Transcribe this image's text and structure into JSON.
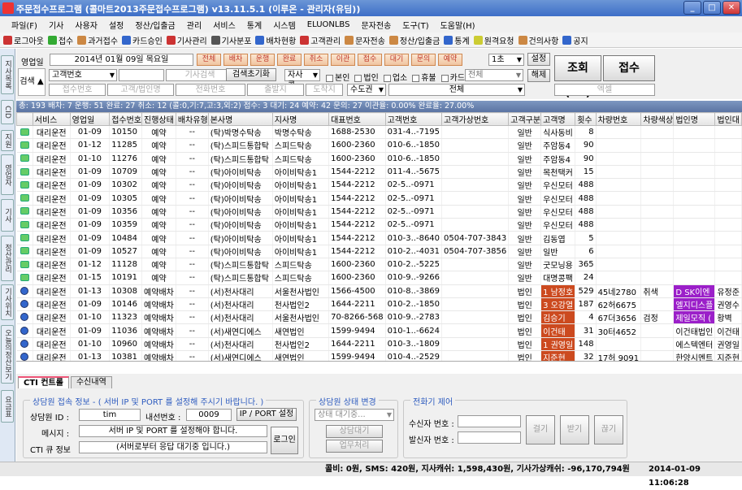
{
  "window": {
    "title": "주문접수프로그램 (콜마트2013주문접수프로그램) v13.11.5.1 (이루온 - 관리자(유딤))"
  },
  "menu": [
    "파일(F)",
    "기사",
    "사용자",
    "설정",
    "정산/입출금",
    "관리",
    "서비스",
    "통계",
    "시스템",
    "ELUONLBS",
    "문자전송",
    "도구(T)",
    "도움말(H)"
  ],
  "toolbar": [
    {
      "label": "로그아웃",
      "color": "#c33"
    },
    {
      "label": "접수",
      "color": "#3a3"
    },
    {
      "label": "과거접수",
      "color": "#c84"
    },
    {
      "label": "카드승인",
      "color": "#36c"
    },
    {
      "label": "기사관리",
      "color": "#c33"
    },
    {
      "label": "기사분포",
      "color": "#555"
    },
    {
      "label": "배차현황",
      "color": "#36c"
    },
    {
      "label": "고객관리",
      "color": "#c33"
    },
    {
      "label": "문자전송",
      "color": "#c84"
    },
    {
      "label": "정산/입출금",
      "color": "#c84"
    },
    {
      "label": "통계",
      "color": "#36c"
    },
    {
      "label": "원격요청",
      "color": "#cc3"
    },
    {
      "label": "건의사항",
      "color": "#c84"
    },
    {
      "label": "공지",
      "color": "#36c"
    }
  ],
  "sidebar_tabs": [
    "지사목록",
    "CID",
    "지원",
    "영업자",
    "기사",
    "정산관리",
    "기사위치",
    "오늘의정산보기",
    "요금표"
  ],
  "search": {
    "sales_day_label": "영업일",
    "date": "2014년 01월 09일 목요일",
    "filters": [
      "전체",
      "배차",
      "운행",
      "완료",
      "취소",
      "이관",
      "접수",
      "대기",
      "문의",
      "예약"
    ],
    "interval": "1초",
    "settings": "설정",
    "search_label": "검색",
    "customer_no": "고객번호",
    "driver_search_ph": "기사검색",
    "reset": "검색초기화",
    "hq_user": "자사콜",
    "chk_self": "본인",
    "chk_corp": "법인",
    "chk_biz": "업소",
    "chk_off": "휴불",
    "chk_card": "카드",
    "all_select": "전체",
    "release": "해제",
    "query_btn": "조회(F5)",
    "accept_btn": "접수",
    "ph_accept_no": "접수번호",
    "ph_customer": "고객/법인명",
    "ph_phone": "전화번호",
    "ph_depart": "출발지",
    "ph_arrive": "도착지",
    "region": "수도권",
    "all_combo": "전체",
    "excel": "엑셀"
  },
  "status_line": "총: 193  배차: 7  운행: 51  완료: 27  취소: 12 (콜:0,기:7,고:3,외:2)  접수: 3  대기: 24  예약: 42  문의: 27  이관율: 0.00%  완료율: 27.00%",
  "grid": {
    "columns": [
      "",
      "서비스",
      "영업일",
      "접수번호",
      "진행상태",
      "배차유형",
      "본사명",
      "지사명",
      "대표번호",
      "고객번호",
      "고객가상번호",
      "고객구분",
      "고객명",
      "횟수",
      "차량번호",
      "차량색상",
      "법인명",
      "법인대"
    ],
    "rows": [
      [
        "g",
        "대리운전",
        "01-09",
        "10150",
        "예약",
        "--",
        "(탁)박명수탁송",
        "박명수탁송",
        "1688-2530",
        "031-4..-7195",
        "",
        "일반",
        "식사동비",
        "8",
        "",
        "",
        "",
        ""
      ],
      [
        "g",
        "대리운전",
        "01-12",
        "11285",
        "예약",
        "--",
        "(탁)스피드통합탁",
        "스피드탁송",
        "1600-2360",
        "010-6..-1850",
        "",
        "일반",
        "주암동4",
        "90",
        "",
        "",
        "",
        ""
      ],
      [
        "g",
        "대리운전",
        "01-10",
        "11276",
        "예약",
        "--",
        "(탁)스피드통합탁",
        "스피드탁송",
        "1600-2360",
        "010-6..-1850",
        "",
        "일반",
        "주암동4",
        "90",
        "",
        "",
        "",
        ""
      ],
      [
        "g",
        "대리운전",
        "01-09",
        "10709",
        "예약",
        "--",
        "(탁)아이비탁송",
        "아이비탁송1",
        "1544-2212",
        "011-4..-5675",
        "",
        "일반",
        "목천택커",
        "15",
        "",
        "",
        "",
        ""
      ],
      [
        "g",
        "대리운전",
        "01-09",
        "10302",
        "예약",
        "--",
        "(탁)아이비탁송",
        "아이비탁송1",
        "1544-2212",
        "02-5..-0971",
        "",
        "일반",
        "우신모터",
        "488",
        "",
        "",
        "",
        ""
      ],
      [
        "g",
        "대리운전",
        "01-09",
        "10305",
        "예약",
        "--",
        "(탁)아이비탁송",
        "아이비탁송1",
        "1544-2212",
        "02-5..-0971",
        "",
        "일반",
        "우신모터",
        "488",
        "",
        "",
        "",
        ""
      ],
      [
        "g",
        "대리운전",
        "01-09",
        "10356",
        "예약",
        "--",
        "(탁)아이비탁송",
        "아이비탁송1",
        "1544-2212",
        "02-5..-0971",
        "",
        "일반",
        "우신모터",
        "488",
        "",
        "",
        "",
        ""
      ],
      [
        "g",
        "대리운전",
        "01-09",
        "10359",
        "예약",
        "--",
        "(탁)아이비탁송",
        "아이비탁송1",
        "1544-2212",
        "02-5..-0971",
        "",
        "일반",
        "우신모터",
        "488",
        "",
        "",
        "",
        ""
      ],
      [
        "g",
        "대리운전",
        "01-09",
        "10484",
        "예약",
        "--",
        "(탁)아이비탁송",
        "아이비탁송1",
        "1544-2212",
        "010-3..-8640",
        "0504-707-3843",
        "일반",
        "김동엽",
        "5",
        "",
        "",
        "",
        ""
      ],
      [
        "g",
        "대리운전",
        "01-09",
        "10527",
        "예약",
        "--",
        "(탁)아이비탁송",
        "아이비탁송1",
        "1544-2212",
        "010-2..-4031",
        "0504-707-3856",
        "일반",
        "일반",
        "6",
        "",
        "",
        "",
        ""
      ],
      [
        "g",
        "대리운전",
        "01-12",
        "11128",
        "예약",
        "--",
        "(탁)스피드통합탁",
        "스피드탁송",
        "1600-2360",
        "010-2..-5225",
        "",
        "일반",
        "굿모닝용",
        "365",
        "",
        "",
        "",
        ""
      ],
      [
        "g",
        "대리운전",
        "01-15",
        "10191",
        "예약",
        "--",
        "(탁)스피드통합탁",
        "스피드탁송",
        "1600-2360",
        "010-9..-9266",
        "",
        "일반",
        "대명콩팩",
        "24",
        "",
        "",
        "",
        ""
      ],
      [
        "b",
        "대리운전",
        "01-13",
        "10308",
        "예약배차",
        "--",
        "(서)천사대리",
        "서울천사법인",
        "1566-4500",
        "010-8..-3869",
        "",
        "법인",
        "1 남정호",
        "529",
        "45네2780",
        "취색",
        "D SK이엔",
        "유정준"
      ],
      [
        "b",
        "대리운전",
        "01-09",
        "10146",
        "예약배차",
        "--",
        "(서)천사대리",
        "천사법인2",
        "1644-2211",
        "010-2..-1850",
        "",
        "법인",
        "3 오강열",
        "187",
        "62허6675",
        "",
        "엘지디스플",
        "권영수"
      ],
      [
        "b",
        "대리운전",
        "01-10",
        "11323",
        "예약배차",
        "--",
        "(서)천사대리",
        "서울천사법인",
        "70-8266-568",
        "010-9..-2783",
        "",
        "법인",
        "김승기",
        "4",
        "67더3656",
        "검정",
        "제일모직 (",
        "황벽"
      ],
      [
        "b",
        "대리운전",
        "01-09",
        "11036",
        "예약배차",
        "--",
        "(서)새연디에스",
        "새연법인",
        "1599-9494",
        "010-1..-6624",
        "",
        "법인",
        "이건태",
        "31",
        "30터4652",
        "",
        "이건태법인",
        "이건태"
      ],
      [
        "b",
        "대리운전",
        "01-10",
        "10960",
        "예약배차",
        "--",
        "(서)천사대리",
        "천사법인2",
        "1644-2211",
        "010-3..-1809",
        "",
        "법인",
        "1 권영일",
        "148",
        "",
        "",
        "에스텍엔터",
        "권영일"
      ],
      [
        "b",
        "대리운전",
        "01-13",
        "10381",
        "예약배차",
        "--",
        "(서)새연디에스",
        "새연법인",
        "1599-9494",
        "010-4..-2529",
        "",
        "법인",
        "지준현",
        "32",
        "17허 9091",
        "",
        "한양시멘트",
        "지준현"
      ]
    ]
  },
  "bottom": {
    "tabs": [
      "CTI 컨트롤",
      "수신내역"
    ],
    "cti_legend": "상담원 접속 정보 - ( 서버 IP 및 PORT 를 설정해 주시기 바랍니다. )",
    "agent_id_label": "상담원 ID :",
    "agent_id": "tim",
    "ext_label": "내선번호 :",
    "ext": "0009",
    "ip_btn": "IP / PORT 설정",
    "msg_label": "메시지 :",
    "msg": "서버 IP 및 PORT 를 설정해야 합니다.",
    "queue_label": "CTI 큐 정보",
    "queue": "(서버로부터 응답 대기중 입니다.)",
    "login_btn": "로그인",
    "state_legend": "상담원 상태 변경",
    "state_select": "상태 대기중...",
    "wait_btn": "상담대기",
    "work_btn": "업무처리",
    "call_legend": "전화기 제어",
    "recv_label": "수신자 번호 :",
    "send_label": "발신자 번호 :",
    "dial_btn": "걸기",
    "answer_btn": "받기",
    "hang_btn": "끊기"
  },
  "statusbar": {
    "info": "콜비: 0원, SMS: 420원, 지사캐쉬: 1,598,430원, 기사가상캐쉬: -96,170,794원",
    "datetime": "2014-01-09 11:06:28"
  }
}
